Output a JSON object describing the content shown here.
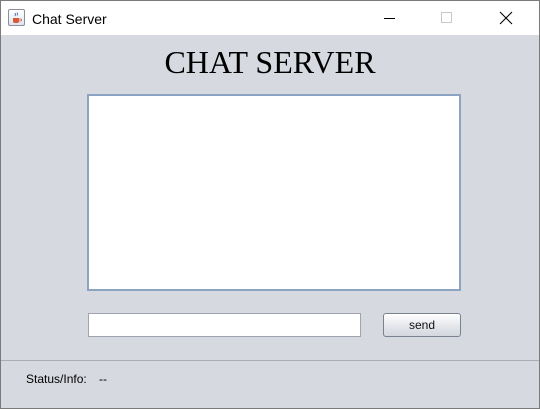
{
  "window": {
    "title": "Chat Server",
    "icon": "java-cup-icon",
    "controls": [
      "minimize-icon",
      "maximize-icon",
      "close-icon"
    ]
  },
  "main": {
    "heading": "CHAT SERVER",
    "chat_log": "",
    "message_input_value": "",
    "send_label": "send"
  },
  "status": {
    "label": "Status/Info:",
    "value": "--"
  },
  "colors": {
    "background": "#d6d9df",
    "chat_border": "#8aa4c1"
  }
}
